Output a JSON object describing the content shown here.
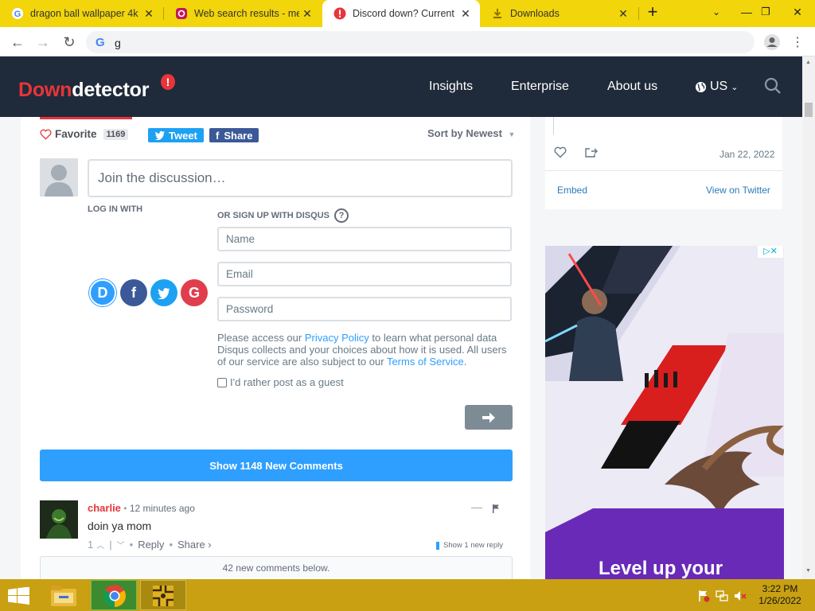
{
  "browser": {
    "tabs": [
      {
        "title": "dragon ball wallpaper 4k",
        "active": false,
        "icon": "google-icon"
      },
      {
        "title": "Web search results - mer",
        "active": false,
        "icon": "search-site-icon"
      },
      {
        "title": "Discord down? Current p",
        "active": true,
        "icon": "downdetector-icon"
      },
      {
        "title": "Downloads",
        "active": false,
        "icon": "download-icon"
      }
    ],
    "omnibox_text": "g"
  },
  "site": {
    "logo_down": "Down",
    "logo_detector": "detector",
    "nav": [
      "Insights",
      "Enterprise",
      "About us"
    ],
    "region": "US"
  },
  "disqus": {
    "favorite_label": "Favorite",
    "favorite_count": "1169",
    "tweet_label": "Tweet",
    "share_label": "Share",
    "sort_label": "Sort by Newest",
    "join_placeholder": "Join the discussion…",
    "login_with": "LOG IN WITH",
    "signup_with": "OR SIGN UP WITH DISQUS",
    "name_placeholder": "Name",
    "email_placeholder": "Email",
    "password_placeholder": "Password",
    "policy_pre": "Please access our ",
    "policy_link": "Privacy Policy",
    "policy_mid": " to learn what personal data Disqus collects and your choices about how it is used. All users of our service are also subject to our ",
    "terms_link": "Terms of Service",
    "policy_end": ".",
    "guest_label": "I'd rather post as a guest",
    "show_new_comments": "Show 1148 New Comments",
    "comment": {
      "author": "charlie",
      "time": "12 minutes ago",
      "text": "doin ya mom",
      "votes": "1",
      "reply": "Reply",
      "share": "Share ›",
      "show_replies": "Show 1 new reply"
    },
    "new_below": "42 new comments below."
  },
  "tweet_card": {
    "date": "Jan 22, 2022",
    "embed": "Embed",
    "view_on_twitter": "View on Twitter"
  },
  "ad": {
    "headline": "Level up your"
  },
  "taskbar": {
    "time": "3:22 PM",
    "date": "1/26/2022"
  },
  "colors": {
    "tab_strip": "#f2d50a",
    "dd_header": "#1f2a3a",
    "dd_red": "#e8353a",
    "disqus_blue": "#2e9fff",
    "twitter": "#1da1f2",
    "facebook": "#3b5998",
    "taskbar": "#c8a012"
  }
}
